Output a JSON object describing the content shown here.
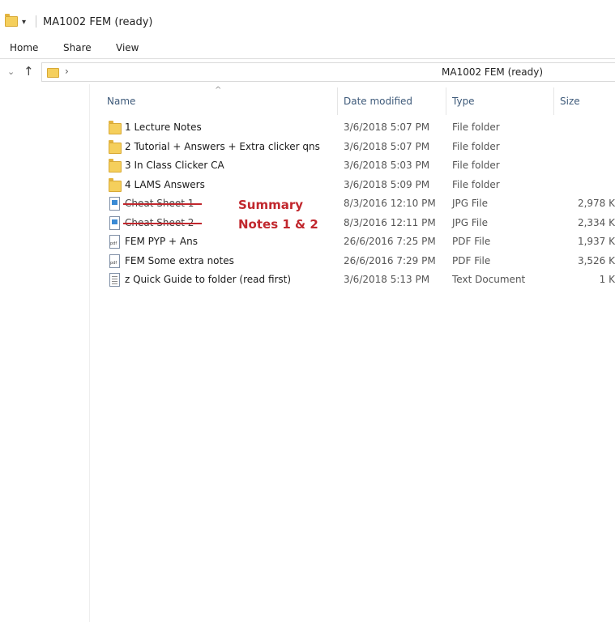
{
  "window": {
    "title": "MA1002 FEM (ready)",
    "quick_access_glyph": "▾"
  },
  "ribbon": {
    "tabs": [
      "Home",
      "Share",
      "View"
    ]
  },
  "address": {
    "back_glyph": "⌄",
    "up_glyph": "↑",
    "chevron": "›",
    "path": "MA1002 FEM (ready)"
  },
  "columns": {
    "name": "Name",
    "date": "Date modified",
    "type": "Type",
    "size": "Size",
    "sort_glyph": "^"
  },
  "files": [
    {
      "name": "1 Lecture Notes",
      "date": "3/6/2018 5:07 PM",
      "type": "File folder",
      "size": "",
      "icon": "folder-icon"
    },
    {
      "name": "2 Tutorial + Answers + Extra clicker qns",
      "date": "3/6/2018 5:07 PM",
      "type": "File folder",
      "size": "",
      "icon": "folder-icon"
    },
    {
      "name": "3 In Class Clicker CA",
      "date": "3/6/2018 5:03 PM",
      "type": "File folder",
      "size": "",
      "icon": "folder-icon"
    },
    {
      "name": "4 LAMS Answers",
      "date": "3/6/2018 5:09 PM",
      "type": "File folder",
      "size": "",
      "icon": "folder-icon"
    },
    {
      "name": "Cheat Sheet 1",
      "date": "8/3/2016 12:10 PM",
      "type": "JPG File",
      "size": "2,978 K",
      "icon": "image-file-icon",
      "annotation": "Summary"
    },
    {
      "name": "Cheat Sheet 2",
      "date": "8/3/2016 12:11 PM",
      "type": "JPG File",
      "size": "2,334 K",
      "icon": "image-file-icon",
      "annotation": "Notes 1 & 2"
    },
    {
      "name": "FEM PYP + Ans",
      "date": "26/6/2016 7:25 PM",
      "type": "PDF File",
      "size": "1,937 K",
      "icon": "pdf-file-icon"
    },
    {
      "name": "FEM Some extra notes",
      "date": "26/6/2016 7:29 PM",
      "type": "PDF File",
      "size": "3,526 K",
      "icon": "pdf-file-icon"
    },
    {
      "name": "z Quick Guide to folder (read first)",
      "date": "3/6/2018 5:13 PM",
      "type": "Text Document",
      "size": "1 K",
      "icon": "text-file-icon"
    }
  ],
  "colors": {
    "annotation_red": "#c1272d",
    "folder_yellow": "#f5cf5c",
    "header_text": "#3e5a7a"
  }
}
